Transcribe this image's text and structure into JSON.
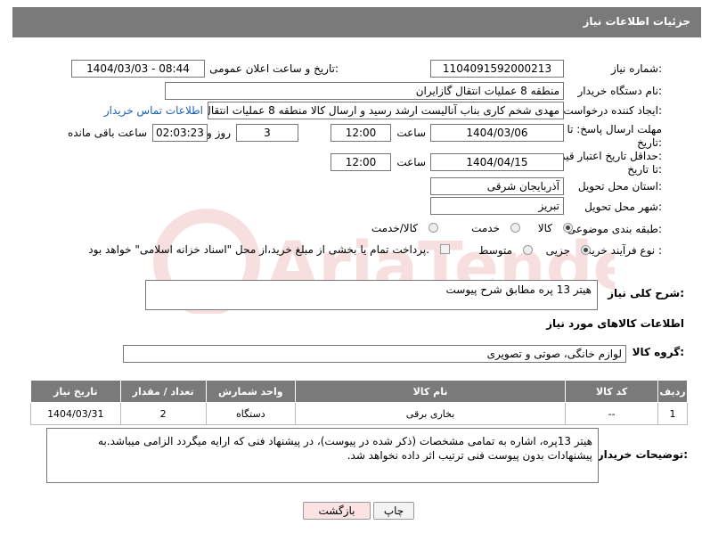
{
  "header": {
    "title": "جزئیات اطلاعات نیاز"
  },
  "form": {
    "need_number_label": "شماره نیاز:",
    "need_number": "1104091592000213",
    "announce_label": "تاریخ و ساعت اعلان عمومی:",
    "announce_value": "1404/03/03 - 08:44",
    "buyer_label": "نام دستگاه خریدار:",
    "buyer_value": "منطقه 8 عملیات انتقال گازایران",
    "creator_label": "ایجاد کننده درخواست:",
    "creator_value": "مهدی شخم کاری بناب آنالیست ارشد رسید و ارسال کالا منطقه 8 عملیات انتقال",
    "contact_link": "اطلاعات تماس خریدار",
    "deadline_label_1": "مهلت ارسال پاسخ: تا",
    "deadline_label_2": "تاریخ:",
    "deadline_date": "1404/03/06",
    "time_label": "ساعت",
    "deadline_time": "12:00",
    "days_value": "3",
    "days_label": "روز و",
    "remaining_time": "02:03:23",
    "remaining_label": "ساعت باقی مانده",
    "price_label_1": "حداقل تاریخ اعتبار قیمت:",
    "price_label_2": "تا تاریخ:",
    "price_date": "1404/04/15",
    "price_time": "12:00",
    "province_label": "استان محل تحویل:",
    "province_value": "آذربایجان شرقی",
    "city_label": "شهر محل تحویل:",
    "city_value": "تبریز",
    "category_label": "طبقه بندی موضوعی:",
    "category_goods": "کالا",
    "category_service": "خدمت",
    "category_both": "کالا/خدمت",
    "process_label": "نوع فرآیند خرید :",
    "process_partial": "جزیی",
    "process_medium": "متوسط",
    "payment_note": "پرداخت تمام یا بخشی از مبلغ خرید،از محل \"اسناد خزانه اسلامی\" خواهد بود."
  },
  "description": {
    "label": "شرح کلی نیاز:",
    "value": "هیتر 13 پره مطابق شرح پیوست"
  },
  "goods_section": {
    "title": "اطلاعات کالاهای مورد نیاز",
    "group_label": "گروه کالا:",
    "group_value": "لوازم خانگی، صوتی و تصویری"
  },
  "table": {
    "headers": {
      "row": "ردیف",
      "code": "کد کالا",
      "name": "نام کالا",
      "unit": "واحد شمارش",
      "qty": "تعداد / مقدار",
      "date": "تاریخ نیاز"
    },
    "rows": [
      {
        "row": "1",
        "code": "--",
        "name": "بخاری برقی",
        "unit": "دستگاه",
        "qty": "2",
        "date": "1404/03/31"
      }
    ]
  },
  "buyer_notes": {
    "label": "توضیحات خریدار:",
    "value": "هیتر 13پره، اشاره به تمامی مشخصات (ذکر شده در پیوست)، در پیشنهاد فنی که ارایه میگردد الزامی میباشد.به پیشنهادات بدون پیوست فنی ترتیب اثر داده نخواهد شد."
  },
  "buttons": {
    "print": "چاپ",
    "back": "بازگشت"
  },
  "watermark": {
    "text": "AriaTender.neT"
  },
  "colors": {
    "header_bg": "#7a7a7a",
    "link": "#1a5fb4",
    "back_button_bg": "#fbe3e3"
  }
}
